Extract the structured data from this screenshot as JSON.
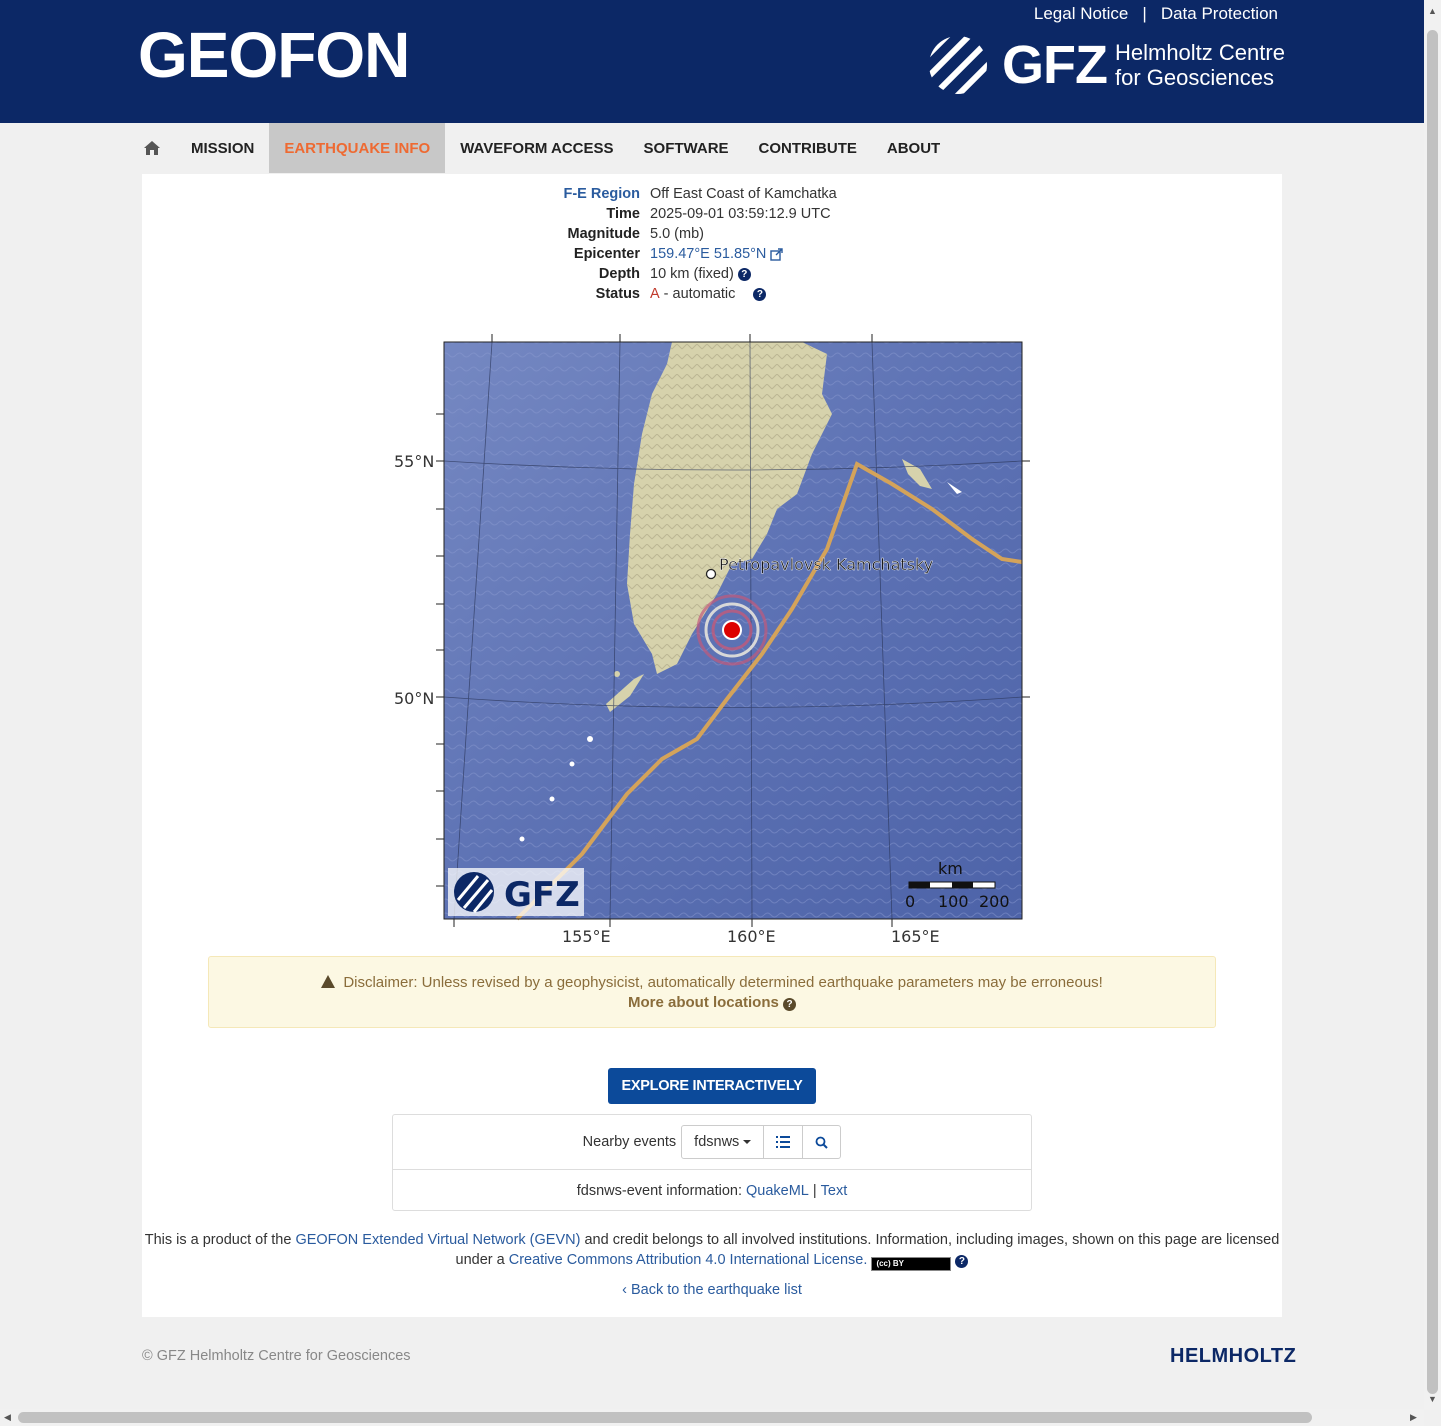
{
  "header": {
    "brand": "GEOFON",
    "legal_notice": "Legal Notice",
    "separator": "|",
    "data_protection": "Data Protection",
    "gfz_logo_text": "GFZ",
    "gfz_sub_line1": "Helmholtz Centre",
    "gfz_sub_line2": "for Geosciences"
  },
  "nav": {
    "items": [
      "MISSION",
      "EARTHQUAKE INFO",
      "WAVEFORM ACCESS",
      "SOFTWARE",
      "CONTRIBUTE",
      "ABOUT"
    ],
    "active": "EARTHQUAKE INFO"
  },
  "event": {
    "region_label": "F-E Region",
    "region": "Off East Coast of Kamchatka",
    "time_label": "Time",
    "time": "2025-09-01 03:59:12.9 UTC",
    "magnitude_label": "Magnitude",
    "magnitude": "5.0 (mb)",
    "epicenter_label": "Epicenter",
    "epicenter": "159.47°E 51.85°N",
    "depth_label": "Depth",
    "depth": "10 km (fixed)",
    "status_label": "Status",
    "status_code": "A",
    "status_text": "- automatic"
  },
  "map": {
    "lat_labels": [
      "55°N",
      "50°N"
    ],
    "lon_labels": [
      "155°E",
      "160°E",
      "165°E"
    ],
    "city": "Petropavlovsk Kamchatsky",
    "watermark": "GFZ",
    "scale_unit": "km",
    "scale_ticks": [
      "0",
      "100",
      "200"
    ]
  },
  "disclaimer": {
    "text": "Disclaimer: Unless revised by a geophysicist, automatically determined earthquake parameters may be erroneous!",
    "more": "More about locations"
  },
  "explore_button": "EXPLORE INTERACTIVELY",
  "nearby": {
    "label": "Nearby events",
    "service": "fdsnws",
    "info_prefix": "fdsnws-event information:",
    "quakeml": "QuakeML",
    "pipe": "|",
    "text": "Text"
  },
  "credits": {
    "part1": "This is a product of the",
    "gevn": "GEOFON Extended Virtual Network (GEVN)",
    "part2": "and credit belongs to all involved institutions. Information, including images, shown on this page are licensed under a",
    "license": "Creative Commons Attribution 4.0 International License.",
    "cc_badge": "(cc) BY"
  },
  "back_link": "Back to the earthquake list",
  "footer": {
    "copyright": "© GFZ Helmholtz Centre for Geosciences",
    "helmholtz": "HELMHOLTZ"
  },
  "colors": {
    "header_bg": "#0c2866",
    "active_nav": "#ee6a32",
    "link": "#2a5b9e",
    "button": "#0c4a9a"
  }
}
